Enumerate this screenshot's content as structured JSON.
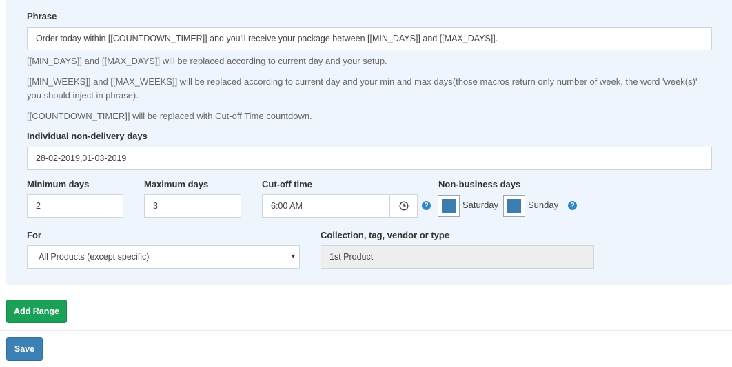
{
  "phrase": {
    "label": "Phrase",
    "value": "Order today within [[COUNTDOWN_TIMER]] and you'll receive your package between [[MIN_DAYS]] and [[MAX_DAYS]].",
    "help1": "[[MIN_DAYS]] and [[MAX_DAYS]] will be replaced according to current day and your setup.",
    "help2a": "[[MIN_WEEKS]] and [[MAX_WEEKS]] will be replaced according to current day and your min and max days(those macros return only number of week, the word 'week(s)'",
    "help2b": "you should inject in phrase).",
    "help3": "[[COUNTDOWN_TIMER]] will be replaced with Cut-off Time countdown."
  },
  "non_delivery": {
    "label": "Individual non-delivery days",
    "value": "28-02-2019,01-03-2019"
  },
  "min_days": {
    "label": "Minimum days",
    "value": "2"
  },
  "max_days": {
    "label": "Maximum days",
    "value": "3"
  },
  "cutoff": {
    "label": "Cut-off time",
    "value": "6:00 AM",
    "icon": "clock-icon"
  },
  "non_business": {
    "label": "Non-business days",
    "days": [
      {
        "label": "Saturday",
        "color": "#3b7cb1"
      },
      {
        "label": "Sunday",
        "color": "#3b7cb1"
      }
    ]
  },
  "for": {
    "label": "For",
    "selected": "All Products (except specific)"
  },
  "collection": {
    "label": "Collection, tag, vendor or type",
    "value": "1st Product"
  },
  "buttons": {
    "add_range": "Add Range",
    "save": "Save"
  },
  "colors": {
    "panel": "#eef5fc",
    "green": "#1aa057",
    "blue": "#3c81b5",
    "help_icon": "#2f87c9"
  }
}
